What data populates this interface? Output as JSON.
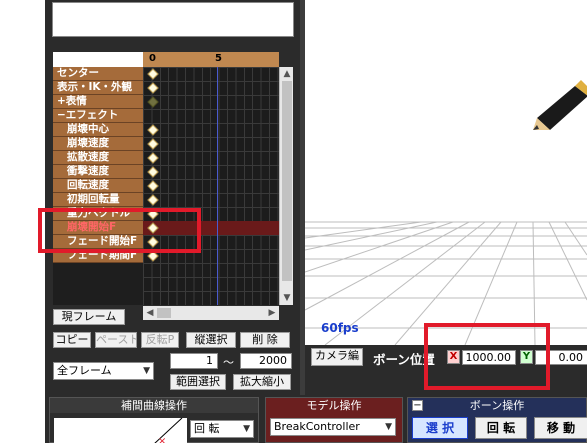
{
  "timeline": {
    "frame_numbers": [
      "0",
      "5"
    ],
    "bones": [
      {
        "label": "センター",
        "indent": false,
        "key": "normal"
      },
      {
        "label": "表示・IK・外観",
        "indent": false,
        "key": "normal"
      },
      {
        "label": "+表情",
        "indent": false,
        "key": "dim"
      },
      {
        "label": "−エフェクト",
        "indent": false,
        "key": "none"
      },
      {
        "label": "崩壊中心",
        "indent": true,
        "key": "normal"
      },
      {
        "label": "崩壊速度",
        "indent": true,
        "key": "normal"
      },
      {
        "label": "拡散速度",
        "indent": true,
        "key": "normal"
      },
      {
        "label": "衝撃速度",
        "indent": true,
        "key": "normal"
      },
      {
        "label": "回転速度",
        "indent": true,
        "key": "normal"
      },
      {
        "label": "初期回転量",
        "indent": true,
        "key": "normal"
      },
      {
        "label": "重力ベクトル",
        "indent": true,
        "key": "normal"
      },
      {
        "label": "崩壊開始F",
        "indent": true,
        "key": "normal",
        "selected": true,
        "highlight": true
      },
      {
        "label": "フェード開始F",
        "indent": true,
        "key": "normal"
      },
      {
        "label": "フェード期間F",
        "indent": true,
        "key": "normal"
      }
    ]
  },
  "controls": {
    "current_frame_label": "現フレーム",
    "copy_label": "コピー",
    "paste_label": "ペースト",
    "reverse_label": "反転P",
    "vertical_select_label": "縦選択",
    "delete_label": "削 除",
    "range_from": "1",
    "range_tilde": "〜",
    "range_to": "2000",
    "frame_filter": "全フレーム",
    "range_select_label": "範囲選択",
    "scale_label": "拡大縮小"
  },
  "viewport": {
    "fps": "60fps",
    "camera_edit_label": "カメラ編",
    "bone_position_label": "ボーン位置",
    "x_axis": "X",
    "x_value": "1000.00",
    "y_axis": "Y",
    "y_value": "0.00"
  },
  "bottom": {
    "interp_title": "補間曲線操作",
    "interp_rotate": "回 転",
    "model_title": "モデル操作",
    "model_select": "BreakController",
    "bone_title": "ボーン操作",
    "bone_collapse": "−",
    "bone_select_label": "選 択",
    "bone_rotate_label": "回 転",
    "bone_move_label": "移 動"
  },
  "colors": {
    "highlight_box": "#e11a2a",
    "bone_label_bg": "#a56b3a",
    "fps_text": "#1a3ecc",
    "model_panel_bg": "#6b1f1f",
    "bone_panel_bg": "#24305a"
  }
}
